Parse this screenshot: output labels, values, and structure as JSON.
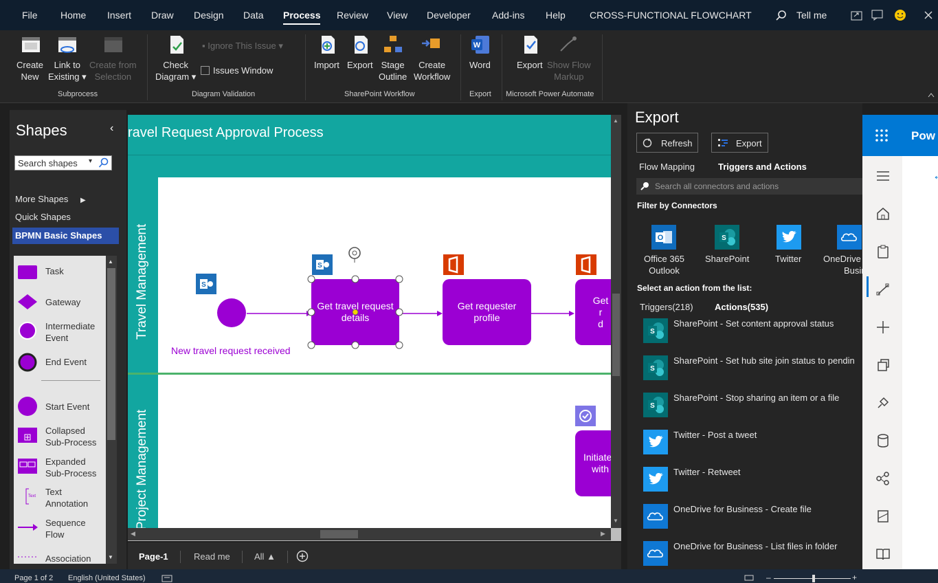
{
  "menubar": {
    "items": [
      "File",
      "Home",
      "Insert",
      "Draw",
      "Design",
      "Data",
      "Process",
      "Review",
      "View",
      "Developer",
      "Add-ins",
      "Help",
      "CROSS-FUNCTIONAL FLOWCHART"
    ],
    "active": "Process",
    "tell_me": "Tell me"
  },
  "ribbon": {
    "subprocess": {
      "create_new": [
        "Create",
        "New"
      ],
      "link_existing": [
        "Link to",
        "Existing"
      ],
      "create_from": [
        "Create from",
        "Selection"
      ],
      "group": "Subprocess"
    },
    "validation": {
      "check": [
        "Check",
        "Diagram"
      ],
      "ignore": "Ignore This Issue",
      "issues": "Issues Window",
      "group": "Diagram Validation"
    },
    "sharepoint": {
      "import": "Import",
      "export": "Export",
      "stage": [
        "Stage",
        "Outline"
      ],
      "create": [
        "Create",
        "Workflow"
      ],
      "group": "SharePoint Workflow"
    },
    "export_grp": {
      "word": "Word",
      "group": "Export"
    },
    "automate": {
      "export": "Export",
      "show": [
        "Show Flow",
        "Markup"
      ],
      "group": "Microsoft Power Automate"
    }
  },
  "shapes": {
    "title": "Shapes",
    "search_placeholder": "Search shapes",
    "more": "More Shapes",
    "quick": "Quick Shapes",
    "selected": "BPMN Basic Shapes",
    "items": [
      [
        "Task",
        ""
      ],
      [
        "Gateway",
        ""
      ],
      [
        "Intermediate",
        "Event"
      ],
      [
        "End Event",
        ""
      ],
      [
        "Start Event",
        ""
      ],
      [
        "Collapsed",
        "Sub-Process"
      ],
      [
        "Expanded",
        "Sub-Process"
      ],
      [
        "Text",
        "Annotation"
      ],
      [
        "Sequence",
        "Flow"
      ],
      [
        "Association",
        ""
      ]
    ]
  },
  "diagram": {
    "title": "ravel Request Approval Process",
    "lane1": "Travel Management",
    "lane2": "Project Management",
    "start_label": "New travel request received",
    "task1": [
      "Get travel request",
      "details"
    ],
    "task2": [
      "Get requester",
      "profile"
    ],
    "task3": [
      "Get r",
      "d"
    ],
    "task4": [
      "Initiate",
      "with"
    ]
  },
  "pages": {
    "page1": "Page-1",
    "readme": "Read me",
    "all": "All"
  },
  "export": {
    "title": "Export",
    "refresh": "Refresh",
    "export_btn": "Export",
    "tab1": "Flow Mapping",
    "tab2": "Triggers and Actions",
    "search_placeholder": "Search all connectors and actions",
    "filter": "Filter by Connectors",
    "connectors": [
      [
        "Office 365",
        "Outlook"
      ],
      [
        "SharePoint",
        ""
      ],
      [
        "Twitter",
        ""
      ],
      [
        "OneDrive",
        "Busines"
      ]
    ],
    "select_label": "Select an action from the list:",
    "triggers": "Triggers(218)",
    "actions_tab": "Actions(535)",
    "actions": [
      "SharePoint - Set content approval status",
      "SharePoint - Set hub site join status to pendin",
      "SharePoint - Stop sharing an item or a file",
      "Twitter - Post a tweet",
      "Twitter - Retweet",
      "OneDrive for Business - Create file",
      "OneDrive for Business - List files in folder"
    ]
  },
  "power_automate": {
    "header": "Pow"
  },
  "status": {
    "page": "Page 1 of 2",
    "lang": "English (United States)"
  },
  "colors": {
    "accent_purple": "#9b00d3",
    "lane_teal": "#12a6a0",
    "pa_blue": "#0078d4",
    "sp_teal": "#036c70",
    "twitter_blue": "#1d9bf0",
    "office_orange": "#d83b01"
  }
}
